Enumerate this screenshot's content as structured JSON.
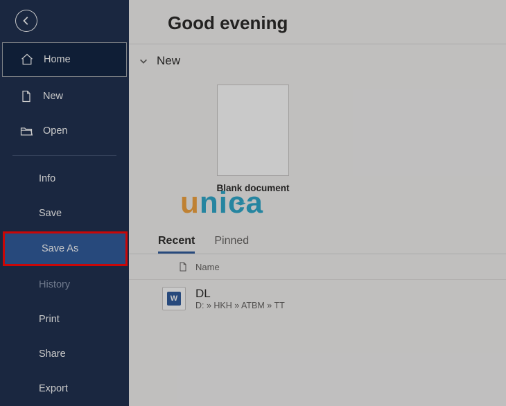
{
  "sidebar": {
    "back_label": "Back",
    "items": [
      {
        "label": "Home",
        "icon": "home-icon",
        "selected": true
      },
      {
        "label": "New",
        "icon": "page-icon"
      },
      {
        "label": "Open",
        "icon": "folder-open-icon"
      }
    ],
    "secondary": [
      {
        "label": "Info"
      },
      {
        "label": "Save"
      },
      {
        "label": "Save As",
        "highlight": true
      },
      {
        "label": "History",
        "dim": true
      },
      {
        "label": "Print"
      },
      {
        "label": "Share"
      },
      {
        "label": "Export"
      }
    ]
  },
  "main": {
    "title": "Good evening",
    "new_section_label": "New",
    "templates": [
      {
        "label": "Blank document"
      }
    ],
    "tabs": [
      {
        "label": "Recent",
        "active": true
      },
      {
        "label": "Pinned"
      }
    ],
    "file_list": {
      "name_header": "Name",
      "rows": [
        {
          "name": "DL",
          "path": "D: » HKH » ATBM » TT"
        }
      ]
    }
  },
  "watermark": {
    "u": "u",
    "rest": "nica"
  }
}
